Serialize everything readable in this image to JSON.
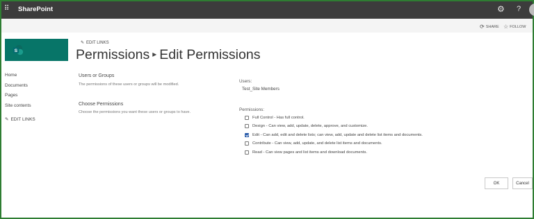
{
  "suite_bar": {
    "brand": "SharePoint",
    "help": "?"
  },
  "command_bar": {
    "share": "SHARE",
    "follow": "FOLLOW"
  },
  "header": {
    "edit_links": "EDIT LINKS",
    "title_part1": "Permissions",
    "title_separator": "▸",
    "title_part2": "Edit Permissions"
  },
  "nav": {
    "items": [
      {
        "label": "Home"
      },
      {
        "label": "Documents"
      },
      {
        "label": "Pages"
      },
      {
        "label": "Site contents"
      }
    ],
    "edit_links": "EDIT LINKS"
  },
  "users_groups": {
    "heading": "Users or Groups",
    "description": "The permissions of these users or groups will be modified.",
    "label": "Users:",
    "value": "Test_Site Members"
  },
  "choose_permissions": {
    "heading": "Choose Permissions",
    "description": "Choose the permissions you want these users or groups to have.",
    "label": "Permissions:",
    "options": [
      {
        "label": "Full Control - Has full control.",
        "checked": false
      },
      {
        "label": "Design - Can view, add, update, delete, approve, and customize.",
        "checked": false
      },
      {
        "label": "Edit - Can add, edit and delete lists; can view, add, update and delete list items and documents.",
        "checked": true
      },
      {
        "label": "Contribute - Can view, add, update, and delete list items and documents.",
        "checked": false
      },
      {
        "label": "Read - Can view pages and list items and download documents.",
        "checked": false
      }
    ]
  },
  "buttons": {
    "ok": "OK",
    "cancel": "Cancel"
  },
  "colors": {
    "suite_bar": "#3c3c3c",
    "site_logo": "#077568",
    "frame": "#2e7d32",
    "checkbox_checked": "#2a5caa"
  }
}
